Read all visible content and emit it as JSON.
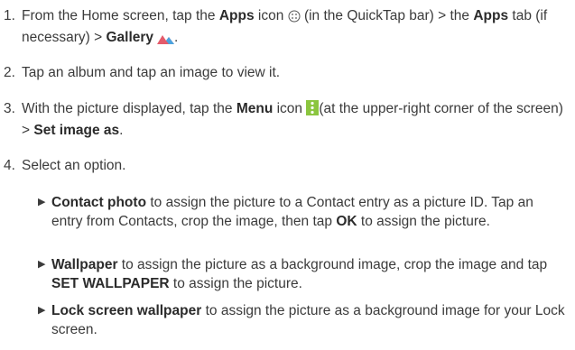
{
  "steps": [
    {
      "num": "1.",
      "t1": "From the Home screen, tap the ",
      "b1": "Apps",
      "t2": " icon ",
      "t3": " (in the QuickTap bar) > the ",
      "b2": "Apps",
      "t4": " tab (if necessary) > ",
      "b3": "Gallery",
      "t5": "."
    },
    {
      "num": "2.",
      "t1": "Tap an album and tap an image to view it."
    },
    {
      "num": "3.",
      "t1": "With the picture displayed, tap the ",
      "b1": "Menu",
      "t2": " icon ",
      "t3": "(at the upper-right corner of the screen) > ",
      "b2": "Set image as",
      "t4": "."
    },
    {
      "num": "4.",
      "t1": "Select an option."
    }
  ],
  "options": [
    {
      "b1": "Contact photo",
      "t1": " to assign the picture to a Contact entry as a picture ID. Tap an entry from Contacts, crop the image, then tap ",
      "b2": "OK",
      "t2": " to assign the picture."
    },
    {
      "b1": "Wallpaper",
      "t1": " to assign the picture as a background image, crop the image and tap ",
      "b2": "SET WALLPAPER",
      "t2": " to assign the picture."
    },
    {
      "b1": "Lock screen wallpaper",
      "t1": " to assign the picture as a background image for your Lock screen."
    }
  ],
  "icons": {
    "apps": "apps-icon",
    "gallery": "gallery-icon",
    "menu": "menu-icon",
    "bullet": "▶",
    "gallery_color": "#e45b6b",
    "menu_color": "#8bc53f"
  }
}
